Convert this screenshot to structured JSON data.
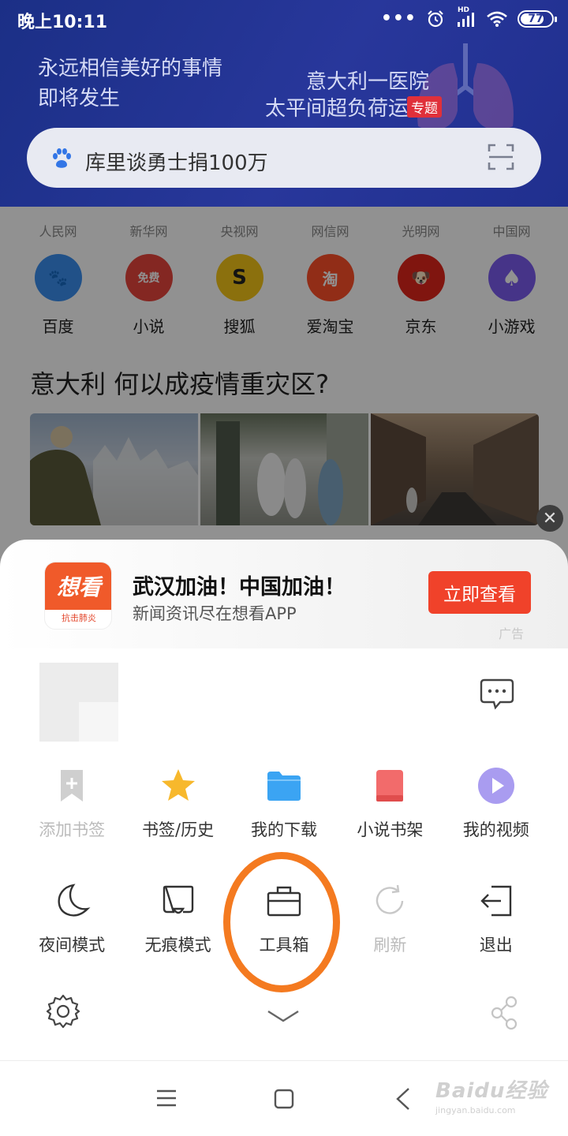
{
  "status_bar": {
    "time": "晚上10:11",
    "network": "HD",
    "battery": "77",
    "battery_level": 0.77
  },
  "hero": {
    "slogan_line1": "永远相信美好的事情",
    "slogan_line2": "即将发生",
    "promo_line1": "意大利一医院",
    "promo_line2": "太平间超负荷运转",
    "promo_tag": "专题"
  },
  "search": {
    "query": "库里谈勇士捐100万"
  },
  "sites": [
    "人民网",
    "新华网",
    "央视网",
    "网信网",
    "光明网",
    "中国网"
  ],
  "apps": [
    {
      "label": "百度",
      "color": "#3a8ff0",
      "glyph": "🐾"
    },
    {
      "label": "小说",
      "color": "#e8463c",
      "glyph": "免费"
    },
    {
      "label": "搜狐",
      "color": "#f5c518",
      "glyph": "S"
    },
    {
      "label": "爱淘宝",
      "color": "#ff4f2a",
      "glyph": "淘"
    },
    {
      "label": "京东",
      "color": "#e1251b",
      "glyph": "🐶"
    },
    {
      "label": "小游戏",
      "color": "#7c5cf0",
      "glyph": "♠"
    }
  ],
  "news": {
    "headline": "意大利 何以成疫情重灾区?"
  },
  "ad": {
    "logo_text": "想看",
    "logo_sub": "抗击肺炎",
    "title": "武汉加油！中国加油！",
    "desc": "新闻资讯尽在想看APP",
    "button": "立即查看",
    "label": "广告",
    "close": "✕"
  },
  "menu": {
    "row1": [
      {
        "label": "添加书签",
        "icon": "bookmark-add-icon",
        "disabled": true
      },
      {
        "label": "书签/历史",
        "icon": "star-icon"
      },
      {
        "label": "我的下载",
        "icon": "folder-icon"
      },
      {
        "label": "小说书架",
        "icon": "book-icon"
      },
      {
        "label": "我的视频",
        "icon": "play-icon"
      }
    ],
    "row2": [
      {
        "label": "夜间模式",
        "icon": "moon-icon"
      },
      {
        "label": "无痕模式",
        "icon": "incognito-icon"
      },
      {
        "label": "工具箱",
        "icon": "toolbox-icon"
      },
      {
        "label": "刷新",
        "icon": "refresh-icon",
        "disabled": true
      },
      {
        "label": "退出",
        "icon": "exit-icon"
      }
    ]
  },
  "watermark": {
    "brand": "Baidu经验",
    "url": "jingyan.baidu.com"
  },
  "colors": {
    "hero_bg": "#26369a",
    "accent": "#f0422a",
    "highlight": "#f47a20"
  }
}
